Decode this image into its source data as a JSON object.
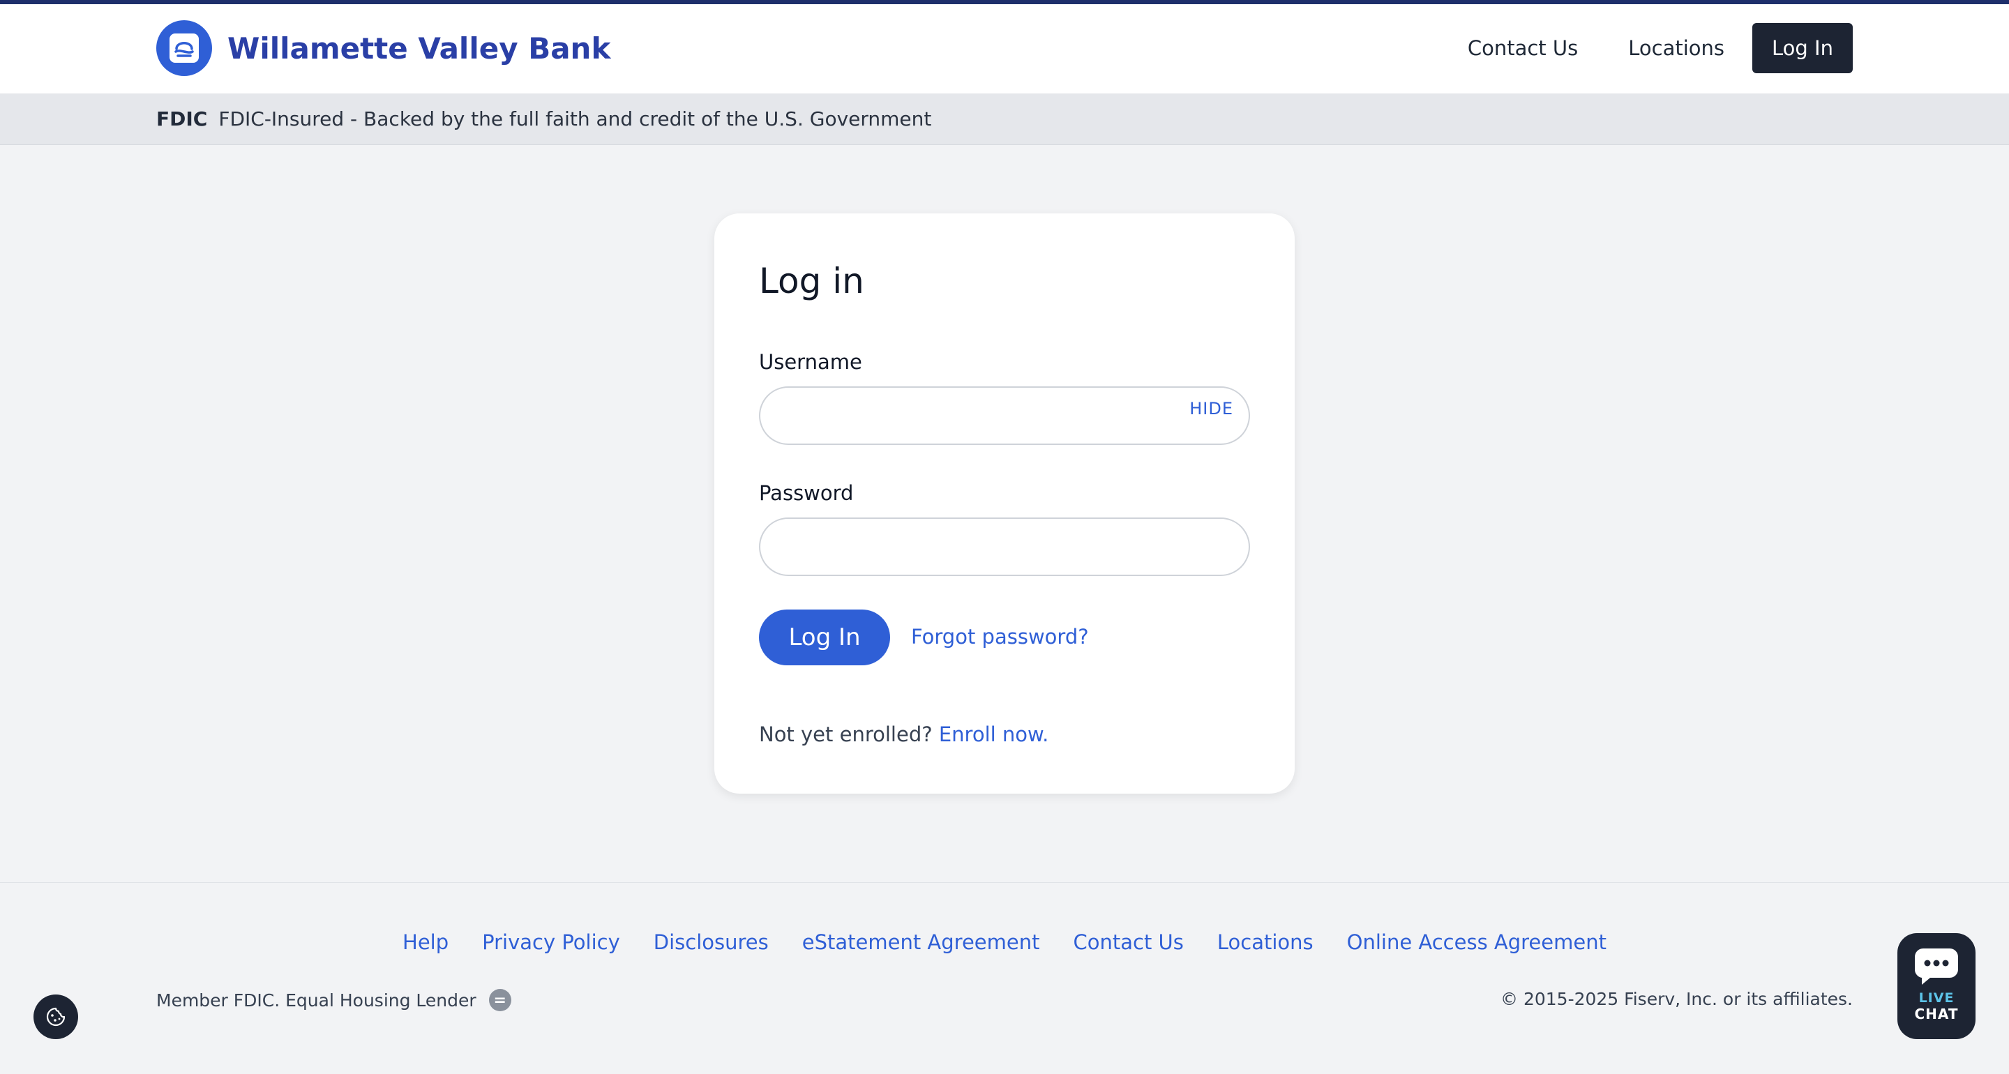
{
  "header": {
    "bank_name": "Willamette Valley Bank",
    "nav": [
      "Contact Us",
      "Locations"
    ],
    "login_label": "Log In"
  },
  "fdic": {
    "mark": "FDIC",
    "text": "FDIC-Insured - Backed by the full faith and credit of the U.S. Government"
  },
  "login": {
    "title": "Log in",
    "username_label": "Username",
    "username_value": "",
    "hide_label": "HIDE",
    "password_label": "Password",
    "password_value": "",
    "submit_label": "Log In",
    "forgot_label": "Forgot password?",
    "enroll_prompt": "Not yet enrolled?",
    "enroll_link": "Enroll now."
  },
  "footer": {
    "links": [
      "Help",
      "Privacy Policy",
      "Disclosures",
      "eStatement Agreement",
      "Contact Us",
      "Locations",
      "Online Access Agreement"
    ],
    "member_text": "Member FDIC. Equal Housing Lender",
    "copyright": "© 2015-2025 Fiserv, Inc. or its affiliates."
  },
  "chat": {
    "live": "LIVE",
    "chat": "CHAT"
  },
  "colors": {
    "brand": "#2a3fa6",
    "accent": "#2f5fd6",
    "dark": "#1d2433",
    "page_bg": "#f2f3f5"
  },
  "icons": [
    "bank-logo-icon",
    "equal-housing-icon",
    "cookie-icon",
    "chat-bubble-icon"
  ]
}
